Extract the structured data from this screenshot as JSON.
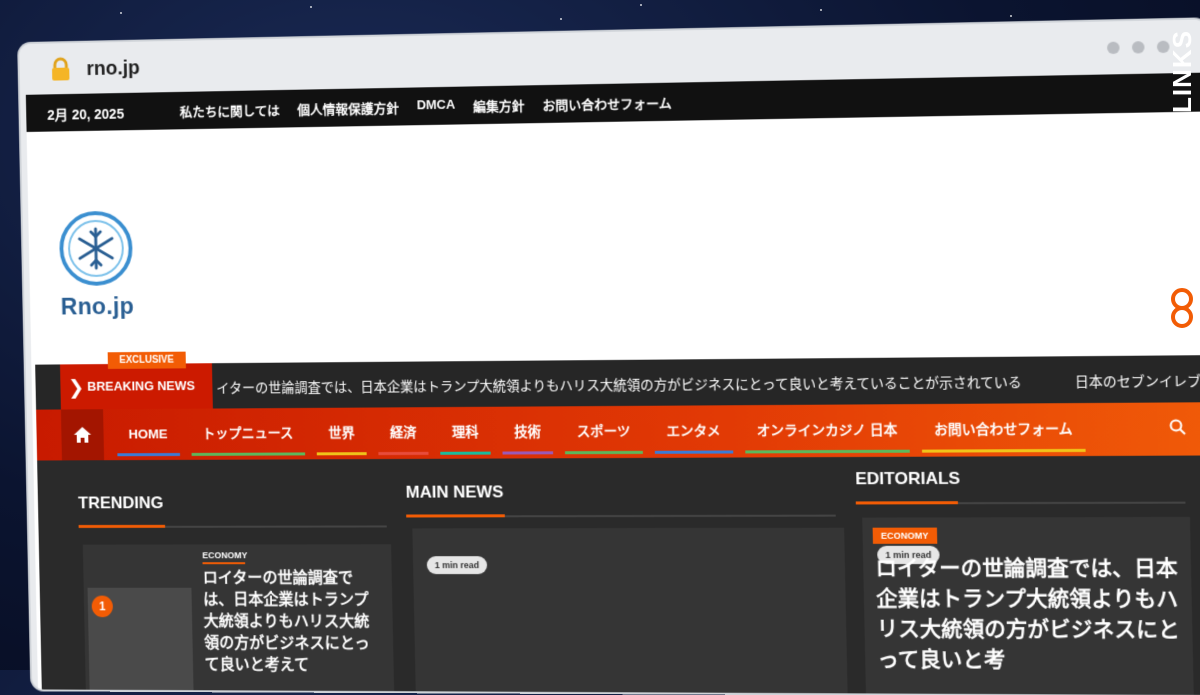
{
  "browser": {
    "url": "rno.jp"
  },
  "topbar": {
    "date": "2月 20, 2025",
    "links": [
      "私たちに関しては",
      "個人情報保護方針",
      "DMCA",
      "編集方針",
      "お問い合わせフォーム"
    ]
  },
  "site": {
    "logo_text": "Rno.jp"
  },
  "breaking": {
    "exclusive": "EXCLUSIVE",
    "label": "BREAKING NEWS",
    "ticker": "イターの世論調査では、日本企業はトランプ大統領よりもハリス大統領の方がビジネスにとって良いと考えていることが示されている",
    "ticker_next": "日本のセブンイレブ"
  },
  "nav": {
    "items": [
      {
        "label": "HOME",
        "color": "#3b7bd6"
      },
      {
        "label": "トップニュース",
        "color": "#5cb85c"
      },
      {
        "label": "世界",
        "color": "#f0c419"
      },
      {
        "label": "経済",
        "color": "#e74c3c"
      },
      {
        "label": "理科",
        "color": "#1abc9c"
      },
      {
        "label": "技術",
        "color": "#9b59b6"
      },
      {
        "label": "スポーツ",
        "color": "#5cb85c"
      },
      {
        "label": "エンタメ",
        "color": "#3b7bd6"
      },
      {
        "label": "オンラインカジノ 日本",
        "color": "#5cb85c"
      },
      {
        "label": "お問い合わせフォーム",
        "color": "#f0c419"
      }
    ]
  },
  "sections": {
    "trending": "TRENDING",
    "main_news": "MAIN NEWS",
    "editorials": "EDITORIALS"
  },
  "trending_item": {
    "rank": "1",
    "category": "ECONOMY",
    "headline": "ロイターの世論調査では、日本企業はトランプ大統領よりもハリス大統領の方がビジネスにとって良いと考えて"
  },
  "main_item": {
    "read_time": "1 min read"
  },
  "editorial_item": {
    "category": "ECONOMY",
    "read_time": "1 min read",
    "headline": "ロイターの世論調査では、日本企業はトランプ大統領よりもハリス大統領の方がビジネスにとって良いと考"
  },
  "watermark": {
    "text": "GUESTPOSTLINKS"
  },
  "colors": {
    "accent": "#f25c05",
    "nav_red": "#c81a00",
    "dark": "#2a2a2a"
  }
}
